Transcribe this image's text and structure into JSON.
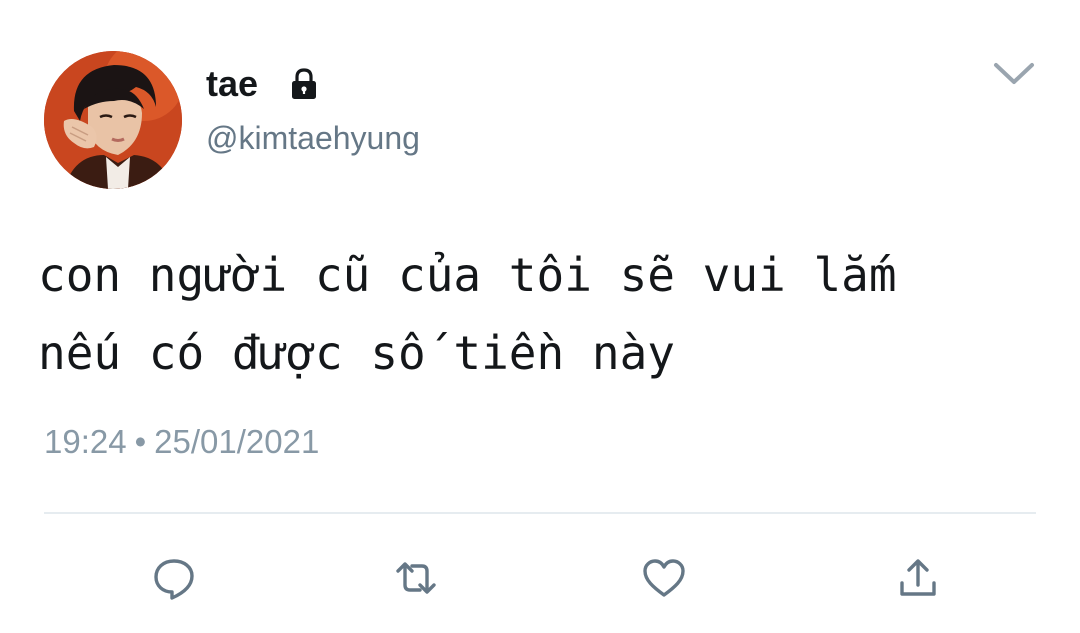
{
  "user": {
    "display_name": "tae",
    "handle": "@kimtaehyung",
    "avatar_icon": "profile-photo",
    "lock_icon": "lock-icon"
  },
  "tweet": {
    "text": "con người cũ của tôi sẽ vui lắm\nnếu có được số tiền này",
    "time": "19:24",
    "separator": "•",
    "date": "25/01/2021"
  },
  "actions": [
    {
      "name": "reply",
      "icon": "comment-icon"
    },
    {
      "name": "retweet",
      "icon": "retweet-icon"
    },
    {
      "name": "like",
      "icon": "heart-icon"
    },
    {
      "name": "share",
      "icon": "share-icon"
    }
  ],
  "colors": {
    "text": "#14171a",
    "secondary": "#657786",
    "muted": "#8899a6",
    "icon": "#657786",
    "divider": "#e6ecf0",
    "avatar_bg": "#c0401f"
  }
}
